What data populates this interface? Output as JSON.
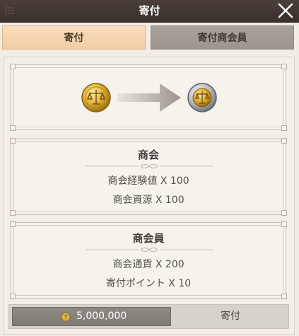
{
  "window": {
    "title": "寄付"
  },
  "tabs": [
    {
      "label": "寄付",
      "active": true
    },
    {
      "label": "寄付商会員",
      "active": false
    }
  ],
  "exchange": {
    "from_icon": "gold-scale-coin-icon",
    "arrow_icon": "arrow-right-icon",
    "to_icon": "silver-scale-coin-icon"
  },
  "guild_card": {
    "heading": "商会",
    "rewards": [
      "商会経験値 X 100",
      "商会資源 X 100"
    ]
  },
  "member_card": {
    "heading": "商会員",
    "rewards": [
      "商会通貨 X 200",
      "寄付ポイント X 10"
    ]
  },
  "footer": {
    "coin_icon": "gold-coin-icon",
    "balance": "5,000,000",
    "donate_label": "寄付"
  },
  "colors": {
    "accent_tab": "#f5d3ae",
    "title_bar": "#3f3531",
    "panel": "#f3efe7"
  }
}
